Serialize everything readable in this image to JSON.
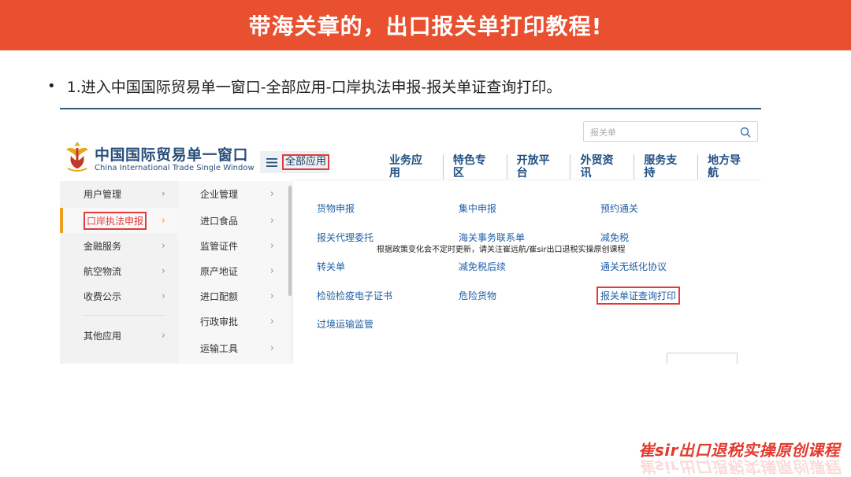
{
  "slide": {
    "title": "带海关章的，出口报关单打印教程!",
    "bullet": "1.进入中国国际贸易单一窗口-全部应用-口岸执法申报-报关单证查询打印。",
    "watermark": "崔sir出口退税实操原创课程"
  },
  "site": {
    "search_placeholder": "报关单",
    "logo_cn": "中国国际贸易单一窗口",
    "logo_en": "China International Trade Single Window",
    "all_apps_label": "全部应用",
    "nav": [
      "业务应用",
      "特色专区",
      "开放平台",
      "外贸资讯",
      "服务支持",
      "地方导航"
    ]
  },
  "menu_col1": [
    {
      "label": "用户管理",
      "chev": "›"
    },
    {
      "label": "口岸执法申报",
      "chev": "›"
    },
    {
      "label": "金融服务",
      "chev": "›"
    },
    {
      "label": "航空物流",
      "chev": "›"
    },
    {
      "label": "收费公示",
      "chev": "›"
    },
    {
      "label": "其他应用",
      "chev": "›"
    }
  ],
  "menu_col2": [
    {
      "label": "企业管理",
      "chev": "›"
    },
    {
      "label": "进口食品",
      "chev": "›"
    },
    {
      "label": "监管证件",
      "chev": "›"
    },
    {
      "label": "原产地证",
      "chev": "›"
    },
    {
      "label": "进口配额",
      "chev": "›"
    },
    {
      "label": "行政审批",
      "chev": "›"
    },
    {
      "label": "运输工具",
      "chev": "›"
    }
  ],
  "panel": {
    "links": [
      "货物申报",
      "集中申报",
      "预约通关",
      "报关代理委托",
      "海关事务联系单",
      "减免税",
      "转关单",
      "减免税后续",
      "通关无纸化协议",
      "检验检疫电子证书",
      "危险货物",
      "报关单证查询打印",
      "过境运输监管"
    ],
    "notice": "根据政策变化会不定时更新，请关注崔远航/崔sir出口退税实操原创课程"
  },
  "colors": {
    "header_bg": "#e8502f",
    "highlight_box": "#e23b3b",
    "nav_text": "#1f4f84",
    "link_text": "#1f5fa8",
    "active_bar": "#f0a020"
  }
}
